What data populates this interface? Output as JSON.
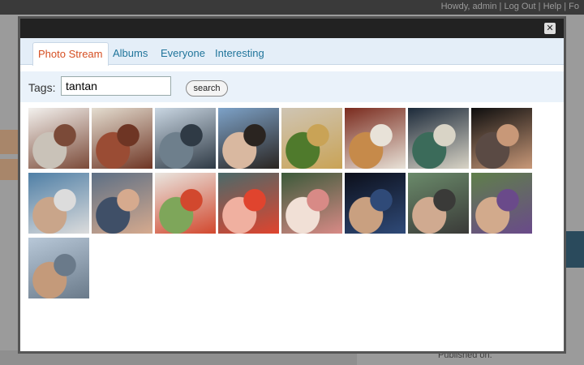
{
  "background": {
    "user_links": "Howdy, admin | Log Out | Help | Fo",
    "published_label": "Published on:"
  },
  "modal": {
    "close_glyph": "✕",
    "tabs": [
      {
        "label": "Photo Stream",
        "active": true
      },
      {
        "label": "Albums",
        "active": false
      },
      {
        "label": "Everyone",
        "active": false
      },
      {
        "label": "Interesting",
        "active": false
      }
    ],
    "search": {
      "tags_label": "Tags:",
      "tags_value": "tantan",
      "button_label": "search"
    }
  },
  "photos": [
    {
      "palette": [
        "#f3f1ee",
        "#7b4a38",
        "#c9c2b8"
      ]
    },
    {
      "palette": [
        "#e4ddd0",
        "#6e3524",
        "#9a4c34"
      ]
    },
    {
      "palette": [
        "#c9d6e2",
        "#2f3a45",
        "#6e7f8c"
      ]
    },
    {
      "palette": [
        "#7da2c8",
        "#2a2420",
        "#d9b8a0"
      ]
    },
    {
      "palette": [
        "#cfc5b4",
        "#c9a356",
        "#4f7a2c"
      ]
    },
    {
      "palette": [
        "#7a2b1e",
        "#e8e2d8",
        "#c68a4a"
      ]
    },
    {
      "palette": [
        "#1c2a3a",
        "#d9d4c6",
        "#3b6b5a"
      ]
    },
    {
      "palette": [
        "#0e0e0e",
        "#c89878",
        "#5a4a44"
      ]
    },
    {
      "palette": [
        "#4f7fa6",
        "#dcdcdc",
        "#c9a58a"
      ]
    },
    {
      "palette": [
        "#5c6f85",
        "#d6aa8e",
        "#3f4f67"
      ]
    },
    {
      "palette": [
        "#e9e6e0",
        "#d2482e",
        "#7ea65a"
      ]
    },
    {
      "palette": [
        "#4a6a6a",
        "#e0442e",
        "#f0b0a0"
      ]
    },
    {
      "palette": [
        "#3b5a3a",
        "#d88a86",
        "#f1e0d6"
      ]
    },
    {
      "palette": [
        "#0c0f1a",
        "#2f4a78",
        "#c9a080"
      ]
    },
    {
      "palette": [
        "#6a8a6a",
        "#3a3a38",
        "#d0aa90"
      ]
    },
    {
      "palette": [
        "#5f7f4a",
        "#6a4a8a",
        "#d2aa8c"
      ]
    },
    {
      "palette": [
        "#b8c8d8",
        "#6a7a8a",
        "#c49a7a"
      ]
    }
  ]
}
